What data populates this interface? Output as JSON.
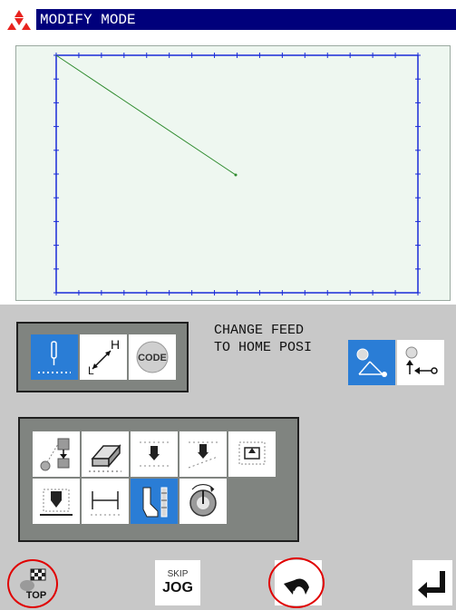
{
  "header": {
    "title": "MODIFY MODE",
    "logo_icon": "mitsubishi-logo"
  },
  "editor": {
    "frame_color": "#1a2bd8",
    "stitch_line_color": "#2e8b2e",
    "background": "#eef7f0"
  },
  "mode_tools": {
    "items": [
      {
        "icon": "needle-stitch-icon",
        "selected": true
      },
      {
        "icon": "height-diagonal-icon",
        "label": "H",
        "selected": false
      },
      {
        "icon": "code-icon",
        "label": "CODE",
        "selected": false
      }
    ]
  },
  "message": {
    "line1": "CHANGE FEED",
    "line2": "TO HOME POSI"
  },
  "feed_tools": {
    "items": [
      {
        "icon": "feed-to-point-icon",
        "selected": true
      },
      {
        "icon": "feed-to-home-icon",
        "selected": false
      }
    ]
  },
  "edit_tools": {
    "items": [
      {
        "icon": "point-move-icon"
      },
      {
        "icon": "eraser-icon"
      },
      {
        "icon": "point-insert-icon"
      },
      {
        "icon": "section-move-icon"
      },
      {
        "icon": "block-move-icon"
      },
      {
        "icon": "block-down-icon"
      },
      {
        "icon": "width-measure-icon"
      },
      {
        "icon": "presser-foot-icon",
        "selected": true
      },
      {
        "icon": "speed-dial-icon"
      }
    ]
  },
  "bottom_bar": {
    "top_label": "TOP",
    "skip_label": "SKIP",
    "jog_label": "JOG",
    "back_icon": "undo-arrow-icon",
    "enter_icon": "enter-icon"
  },
  "accent": "#2a7dd6",
  "highlight_ring": "#e00000"
}
